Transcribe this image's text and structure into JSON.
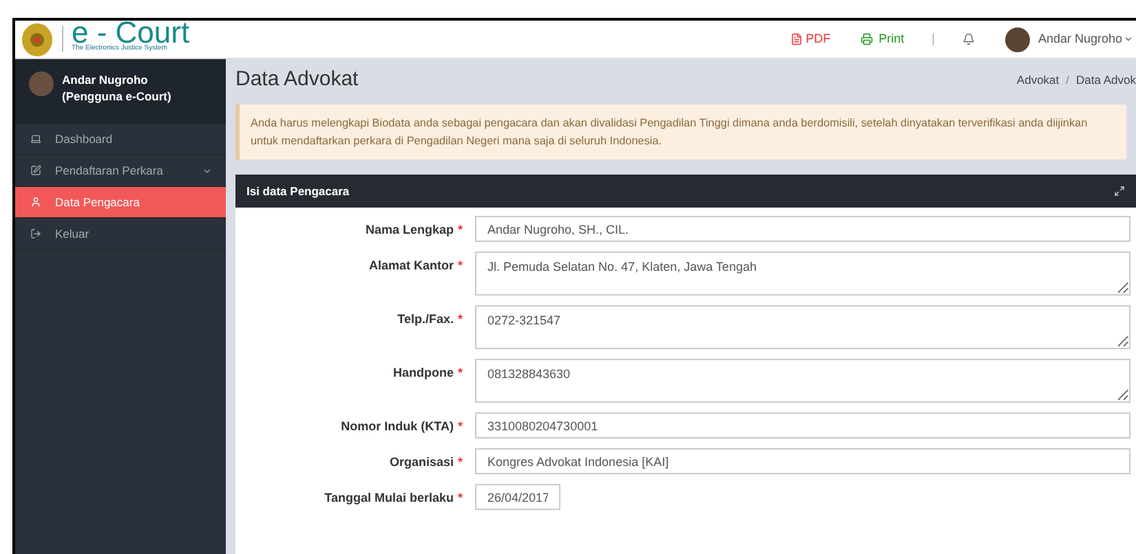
{
  "brand": {
    "title": "e - Court",
    "subtitle": "The Electronics Justice System"
  },
  "topbar": {
    "pdf": "PDF",
    "print": "Print",
    "separator": "|",
    "user": "Andar Nugroho"
  },
  "sidebar": {
    "user_name": "Andar Nugroho",
    "user_role": "(Pengguna e-Court)",
    "items": [
      {
        "label": "Dashboard",
        "selected": false,
        "has_submenu": false
      },
      {
        "label": "Pendaftaran Perkara",
        "selected": false,
        "has_submenu": true
      },
      {
        "label": "Data Pengacara",
        "selected": true,
        "has_submenu": false
      },
      {
        "label": "Keluar",
        "selected": false,
        "has_submenu": false
      }
    ]
  },
  "page": {
    "title": "Data Advokat",
    "breadcrumb": [
      "Advokat",
      "Data Advok"
    ],
    "breadcrumb_separator": "/"
  },
  "alert": "Anda harus melengkapi Biodata anda sebagai pengacara dan akan divalidasi Pengadilan Tinggi dimana anda berdomisili, setelah dinyatakan terverifikasi anda diijinkan untuk mendaftarkan perkara di Pengadilan Negeri mana saja di seluruh Indonesia.",
  "form": {
    "title": "Isi data Pengacara",
    "fields": [
      {
        "label": "Nama Lengkap",
        "required_mark": "*",
        "kind": "input",
        "value": "Andar Nugroho, SH., CIL."
      },
      {
        "label": "Alamat Kantor",
        "required_mark": "*",
        "kind": "textarea",
        "value": "Jl. Pemuda Selatan No. 47, Klaten, Jawa Tengah"
      },
      {
        "label": "Telp./Fax.",
        "required_mark": "*",
        "kind": "textarea",
        "value": "0272-321547"
      },
      {
        "label": "Handpone",
        "required_mark": "*",
        "kind": "textarea",
        "value": "081328843630"
      },
      {
        "label": "Nomor Induk (KTA)",
        "required_mark": "*",
        "kind": "input",
        "value": "3310080204730001"
      },
      {
        "label": "Organisasi",
        "required_mark": "*",
        "kind": "input",
        "value": "Kongres Advokat Indonesia [KAI]"
      },
      {
        "label": "Tanggal Mulai berlaku",
        "required_mark": "*",
        "kind": "date",
        "value": "26/04/2017"
      }
    ]
  }
}
